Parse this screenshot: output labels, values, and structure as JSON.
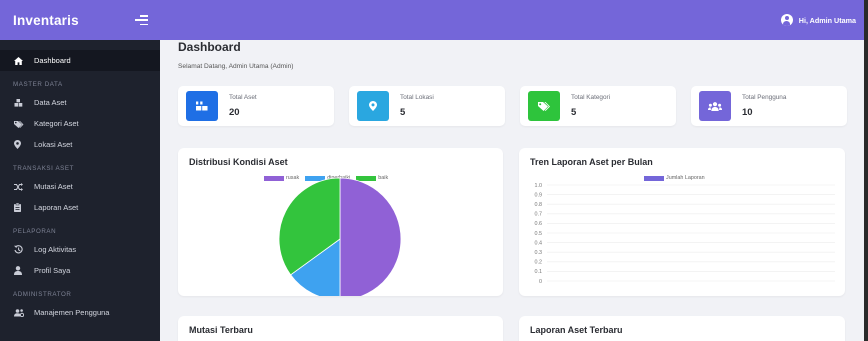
{
  "app": {
    "title": "Inventaris"
  },
  "user": {
    "greeting": "Hi, Admin Utama"
  },
  "sidebar": {
    "active": {
      "label": "Dashboard",
      "icon": "home-icon"
    },
    "sections": [
      {
        "title": "MASTER DATA",
        "items": [
          {
            "label": "Data Aset",
            "icon": "boxes-icon"
          },
          {
            "label": "Kategori Aset",
            "icon": "tags-icon"
          },
          {
            "label": "Lokasi Aset",
            "icon": "map-marker-icon"
          }
        ]
      },
      {
        "title": "TRANSAKSI ASET",
        "items": [
          {
            "label": "Mutasi Aset",
            "icon": "random-icon"
          },
          {
            "label": "Laporan Aset",
            "icon": "clipboard-icon"
          }
        ]
      },
      {
        "title": "PELAPORAN",
        "items": [
          {
            "label": "Log Aktivitas",
            "icon": "history-icon"
          },
          {
            "label": "Profil Saya",
            "icon": "user-icon"
          }
        ]
      },
      {
        "title": "ADMINISTRATOR",
        "items": [
          {
            "label": "Manajemen Pengguna",
            "icon": "users-cog-icon"
          }
        ]
      }
    ]
  },
  "main": {
    "title": "Dashboard",
    "welcome": "Selamat Datang, Admin Utama (Admin)",
    "stats": [
      {
        "label": "Total Aset",
        "value": "20",
        "color": "#1f6fe5",
        "icon": "boxes-icon"
      },
      {
        "label": "Total Lokasi",
        "value": "5",
        "color": "#2aa7e0",
        "icon": "map-marker-icon"
      },
      {
        "label": "Total Kategori",
        "value": "5",
        "color": "#2ec43c",
        "icon": "tags-icon"
      },
      {
        "label": "Total Pengguna",
        "value": "10",
        "color": "#7466d9",
        "icon": "users-icon"
      }
    ],
    "panels": {
      "mutasi": "Mutasi Terbaru",
      "laporan": "Laporan Aset Terbaru"
    }
  },
  "colors": {
    "accent": "#7466d9",
    "sidebar": "#1e222d"
  },
  "chart_data": [
    {
      "type": "pie",
      "title": "Distribusi Kondisi Aset",
      "categories": [
        "rusak",
        "diperbaiki",
        "baik"
      ],
      "values": [
        10,
        3,
        7
      ],
      "colors": [
        "#9061d6",
        "#3ea2f0",
        "#33c43d"
      ],
      "legend": "top"
    },
    {
      "type": "line",
      "title": "Tren Laporan Aset per Bulan",
      "series": [
        {
          "name": "Jumlah Laporan",
          "values": [],
          "color": "#7466d9"
        }
      ],
      "yticks": [
        "1.0",
        "0.9",
        "0.8",
        "0.7",
        "0.6",
        "0.5",
        "0.4",
        "0.3",
        "0.2",
        "0.1",
        "0"
      ],
      "ylim": [
        0,
        1
      ],
      "grid": true,
      "legend": "top"
    }
  ]
}
